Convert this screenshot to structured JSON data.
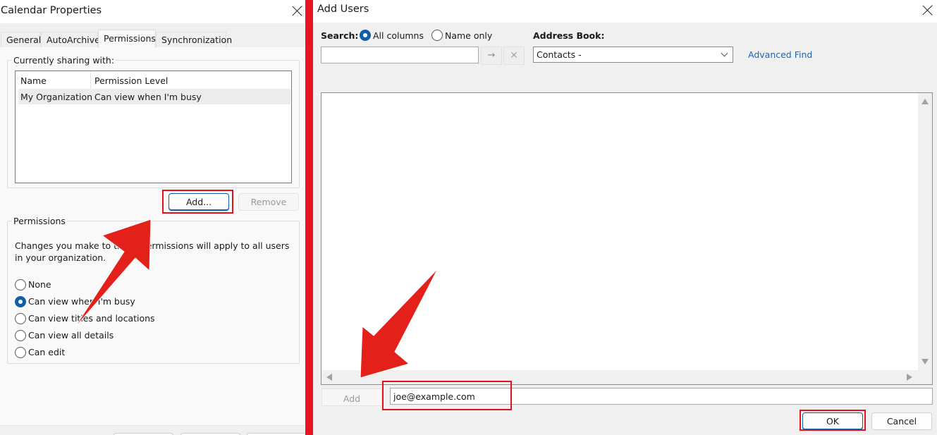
{
  "calendar_properties": {
    "title": "Calendar Properties",
    "tabs": [
      {
        "label": "General",
        "active": false
      },
      {
        "label": "AutoArchive",
        "active": false
      },
      {
        "label": "Permissions",
        "active": true
      },
      {
        "label": "Synchronization",
        "active": false
      }
    ],
    "sharing": {
      "group_label": "Currently sharing with:",
      "columns": [
        "Name",
        "Permission Level"
      ],
      "rows": [
        {
          "name": "My Organization",
          "permission_level": "Can view when I'm busy"
        }
      ]
    },
    "add_button": "Add...",
    "remove_button": "Remove",
    "permissions": {
      "group_label": "Permissions",
      "description": "Changes you make to these permissions will apply to all users in your organization.",
      "options": [
        {
          "label": "None",
          "checked": false
        },
        {
          "label": "Can view when I'm busy",
          "checked": true
        },
        {
          "label": "Can view titles and locations",
          "checked": false
        },
        {
          "label": "Can view all details",
          "checked": false
        },
        {
          "label": "Can edit",
          "checked": false
        }
      ]
    }
  },
  "add_users": {
    "title": "Add Users",
    "search_label": "Search:",
    "search_options": [
      {
        "label": "All columns",
        "checked": true
      },
      {
        "label": "Name only",
        "checked": false
      }
    ],
    "search_value": "",
    "go_icon": "→",
    "clear_icon": "✕",
    "address_book_label": "Address Book:",
    "address_book_value": "Contacts -",
    "advanced_find": "Advanced Find",
    "add_button": "Add",
    "recipient_value": "joe@example.com",
    "ok_button": "OK",
    "cancel_button": "Cancel"
  },
  "colors": {
    "annotation_red": "#e3111c",
    "accent_blue": "#0f5ea8",
    "link_blue": "#1e63b3"
  }
}
